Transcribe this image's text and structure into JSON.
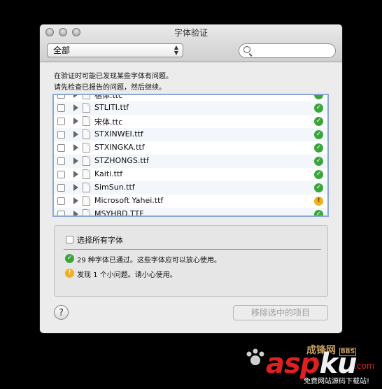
{
  "window": {
    "title": "字体验证"
  },
  "toolbar": {
    "filter_value": "全部",
    "search_value": ""
  },
  "message": {
    "line1": "在验证时可能已发现某些字体有问题。",
    "line2": "请先检查已报告的问题，然后继续。"
  },
  "fonts": [
    {
      "name": "楷体.ttc",
      "status": "ok"
    },
    {
      "name": "STLITI.ttf",
      "status": "ok"
    },
    {
      "name": "宋体.ttc",
      "status": "ok"
    },
    {
      "name": "STXINWEI.ttf",
      "status": "ok"
    },
    {
      "name": "STXINGKA.ttf",
      "status": "ok"
    },
    {
      "name": "STZHONGS.ttf",
      "status": "ok"
    },
    {
      "name": "Kaiti.ttf",
      "status": "ok"
    },
    {
      "name": "SimSun.ttf",
      "status": "ok"
    },
    {
      "name": "Microsoft Yahei.ttf",
      "status": "warn"
    },
    {
      "name": "MSYHBD.TTF",
      "status": "ok"
    }
  ],
  "summary": {
    "select_all_label": "选择所有字体",
    "passed_text": "29 种字体已通过。这些字体应可以放心使用。",
    "issues_text": "发现 1 个小问题。请小心使用。"
  },
  "buttons": {
    "help_label": "?",
    "remove_label": "移除选中的项目"
  },
  "icons": {
    "ok_glyph": "✓",
    "warn_glyph": "!",
    "ok_color": "#3aa63a",
    "warn_color": "#f0b020"
  },
  "watermark": {
    "site": "成锋网",
    "bbs": "BBS",
    "brand_a": "asp",
    "brand_b": "ku",
    "brand_tld": ".com",
    "slogan": "免费网站源码下载站!"
  }
}
